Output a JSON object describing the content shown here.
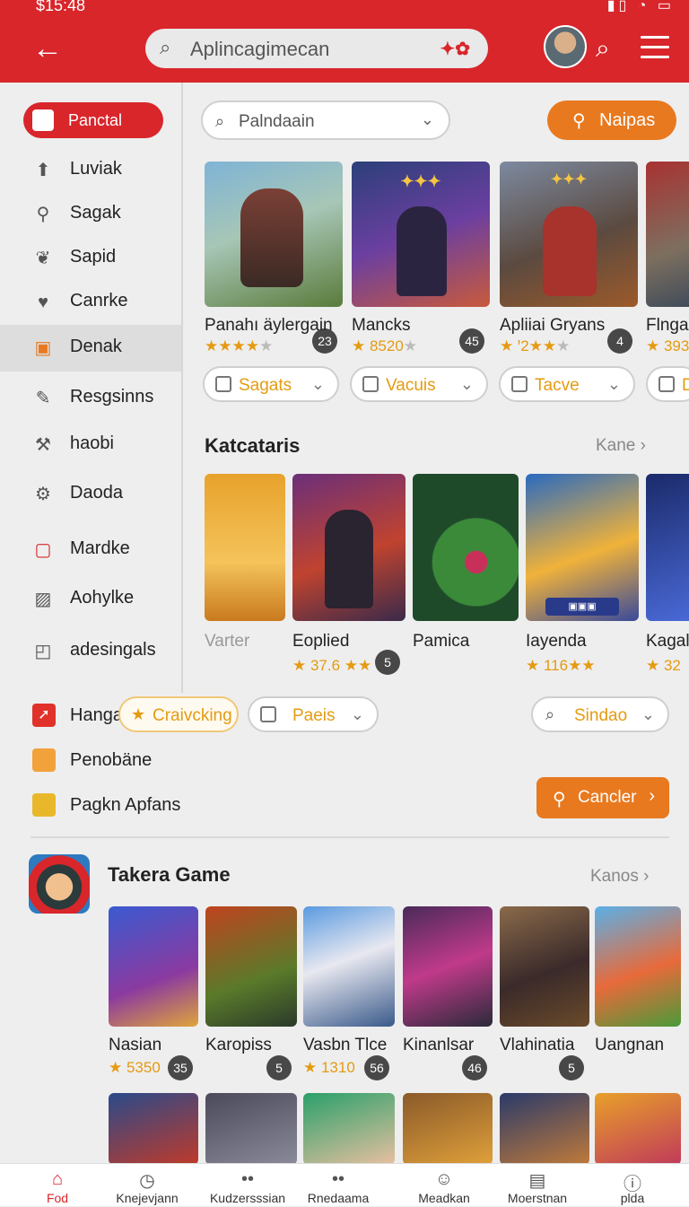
{
  "status_bar": {
    "time": "$15:48",
    "icons": "▮▯ ◔ ▭"
  },
  "header": {
    "back_icon": "arrow-left-icon",
    "search": {
      "text": "Aplincagimecan",
      "logo": "✦✿"
    },
    "icons": [
      "avatar",
      "search-icon",
      "menu-icon"
    ]
  },
  "sidebar": {
    "active": {
      "label": "Panctal",
      "icon": "briefcase-icon"
    },
    "items": [
      {
        "label": "Luviak",
        "icon": "upload-icon"
      },
      {
        "label": "Sagak",
        "icon": "tool-icon"
      },
      {
        "label": "Sapid",
        "icon": "leaf-icon"
      },
      {
        "label": "Canrke",
        "icon": "heart-icon"
      },
      {
        "label": "Denak",
        "icon": "box-icon"
      },
      {
        "label": "Resgsinns",
        "icon": "pencil-icon"
      },
      {
        "label": "haobi",
        "icon": "wrench-icon"
      },
      {
        "label": "Daoda",
        "icon": "gear-icon"
      },
      {
        "label": "Mardke",
        "icon": "square-g-icon"
      },
      {
        "label": "Aohylke",
        "icon": "image-icon"
      },
      {
        "label": "adesingals",
        "icon": "tag-icon"
      }
    ]
  },
  "filter": {
    "dropdown": "Palndaain",
    "button": "Naipas"
  },
  "featured": [
    {
      "title": "Panahı äylergain",
      "rating": "★★★★",
      "rating_gray": "★",
      "badge": "23"
    },
    {
      "title": "Mancks",
      "rating": "★ 8520",
      "rating_gray": "★",
      "badge": "45"
    },
    {
      "title": "Apliiai Gryans",
      "rating": "★ ꞌ2★★",
      "rating_gray": "★",
      "badge": "4"
    },
    {
      "title": "Flngai",
      "rating": "★ 393",
      "rating_gray": "",
      "badge": ""
    }
  ],
  "pills": [
    {
      "label": "Sagats"
    },
    {
      "label": "Vacuis"
    },
    {
      "label": "Tacve"
    },
    {
      "label": "D"
    }
  ],
  "categories": {
    "title": "Katcataris",
    "more": "Kane",
    "items": [
      {
        "title": "Varter",
        "rating": "",
        "badge": ""
      },
      {
        "title": "Eoplied",
        "rating": "★ 37.6 ★★",
        "badge": "5"
      },
      {
        "title": "Pamica",
        "rating": "",
        "badge": ""
      },
      {
        "title": "Iayenda",
        "rating": "★ 116★★",
        "badge": ""
      },
      {
        "title": "Kagal",
        "rating": "★ 32",
        "badge": ""
      }
    ]
  },
  "lower_sidebar": [
    {
      "label": "Hanga",
      "icon": "rocket-icon"
    },
    {
      "label": "Penobäne",
      "icon": "square-icon"
    },
    {
      "label": "Pagkn Apfans",
      "icon": "lock-icon"
    }
  ],
  "chips": {
    "highlight": "Craivcking",
    "paeis": "Paeis",
    "sindao": "Sindao",
    "cancel": "Cancler"
  },
  "takera": {
    "title": "Takera Game",
    "more": "Kanos",
    "items": [
      {
        "title": "Nasian",
        "rating": "★ 5350",
        "badge": "35"
      },
      {
        "title": "Karopiss",
        "rating": "",
        "badge": "5"
      },
      {
        "title": "Vasbn Tlce",
        "rating": "★ 1310",
        "badge": "56"
      },
      {
        "title": "Kinanlsar",
        "rating": "",
        "badge": "46"
      },
      {
        "title": "Vlahinatia",
        "rating": "",
        "badge": "5"
      },
      {
        "title": "Uangnan",
        "rating": "",
        "badge": ""
      }
    ]
  },
  "bottom_nav": [
    {
      "label": "Fod",
      "icon": "home-icon"
    },
    {
      "label": "Knejevjann",
      "icon": "clock-icon"
    },
    {
      "label": "Kudzersssian",
      "icon": "dots-icon"
    },
    {
      "label": "Rnedaama",
      "icon": "dots-icon"
    },
    {
      "label": "Meadkan",
      "icon": "user-icon"
    },
    {
      "label": "Moerstnan",
      "icon": "briefcase-icon"
    },
    {
      "label": "plda",
      "icon": "info-icon"
    }
  ],
  "colors": {
    "brand": "#d8262b",
    "accent": "#e8791f",
    "rating": "#e49b12"
  }
}
